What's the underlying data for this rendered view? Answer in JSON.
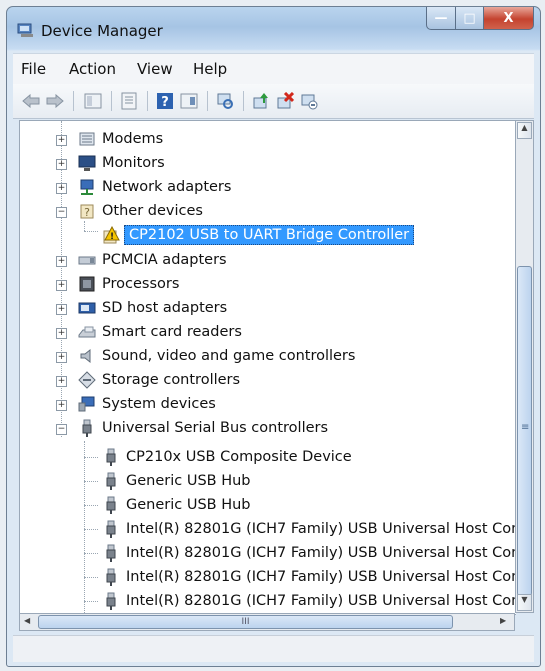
{
  "window": {
    "title": "Device Manager",
    "caption_buttons": {
      "minimize": "—",
      "maximize": "□",
      "close": "X"
    }
  },
  "menu": [
    "File",
    "Action",
    "View",
    "Help"
  ],
  "toolbar_icons": [
    "back-arrow-icon",
    "forward-arrow-icon",
    "show-hide-tree-icon",
    "properties-icon",
    "help-icon",
    "view-icon",
    "scan-hardware-icon",
    "update-driver-icon",
    "uninstall-icon",
    "disable-icon"
  ],
  "tree": [
    {
      "label": "Modems",
      "level": 0,
      "expanded": false,
      "icon": "modem-icon"
    },
    {
      "label": "Monitors",
      "level": 0,
      "expanded": false,
      "icon": "monitor-icon"
    },
    {
      "label": "Network adapters",
      "level": 0,
      "expanded": false,
      "icon": "network-adapter-icon"
    },
    {
      "label": "Other devices",
      "level": 0,
      "expanded": true,
      "icon": "unknown-device-icon"
    },
    {
      "label": "CP2102 USB to UART Bridge Controller",
      "level": 1,
      "selected": true,
      "icon": "warning-device-icon"
    },
    {
      "label": "PCMCIA adapters",
      "level": 0,
      "expanded": false,
      "icon": "pcmcia-icon"
    },
    {
      "label": "Processors",
      "level": 0,
      "expanded": false,
      "icon": "processor-icon"
    },
    {
      "label": "SD host adapters",
      "level": 0,
      "expanded": false,
      "icon": "sd-card-icon"
    },
    {
      "label": "Smart card readers",
      "level": 0,
      "expanded": false,
      "icon": "smart-card-reader-icon"
    },
    {
      "label": "Sound, video and game controllers",
      "level": 0,
      "expanded": false,
      "icon": "speaker-icon"
    },
    {
      "label": "Storage controllers",
      "level": 0,
      "expanded": false,
      "icon": "storage-controller-icon"
    },
    {
      "label": "System devices",
      "level": 0,
      "expanded": false,
      "icon": "system-device-icon"
    },
    {
      "label": "Universal Serial Bus controllers",
      "level": 0,
      "expanded": true,
      "icon": "usb-plug-icon"
    },
    {
      "label": "CP210x USB Composite Device",
      "level": 1,
      "icon": "usb-plug-icon"
    },
    {
      "label": "Generic USB Hub",
      "level": 1,
      "icon": "usb-plug-icon"
    },
    {
      "label": "Generic USB Hub",
      "level": 1,
      "icon": "usb-plug-icon"
    },
    {
      "label": "Intel(R) 82801G (ICH7 Family) USB Universal Host Cont",
      "level": 1,
      "icon": "usb-plug-icon"
    },
    {
      "label": "Intel(R) 82801G (ICH7 Family) USB Universal Host Cont",
      "level": 1,
      "icon": "usb-plug-icon"
    },
    {
      "label": "Intel(R) 82801G (ICH7 Family) USB Universal Host Cont",
      "level": 1,
      "icon": "usb-plug-icon"
    },
    {
      "label": "Intel(R) 82801G (ICH7 Family) USB Universal Host Cont",
      "level": 1,
      "icon": "usb-plug-icon"
    }
  ],
  "scrollbars": {
    "vertical_thumb_grip": "≡",
    "horizontal_thumb_grip": "III"
  },
  "colors": {
    "selection": "#3399ff",
    "title_gradient": "#a6c4e4",
    "close_button": "#c4432f"
  }
}
